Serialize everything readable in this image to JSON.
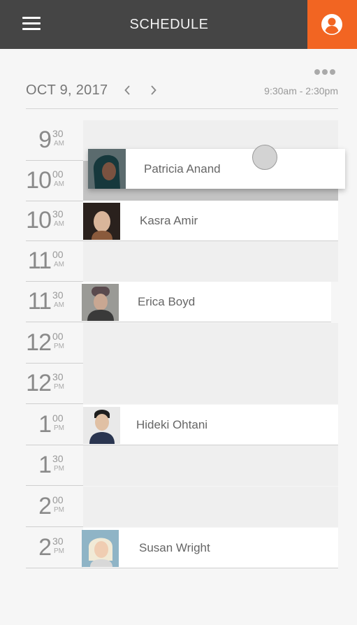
{
  "header": {
    "title": "SCHEDULE",
    "menu_icon": "hamburger-menu-icon",
    "user_icon": "user-profile-icon",
    "accent": "#f26522"
  },
  "toolbar": {
    "more_icon": "more-dots-icon"
  },
  "date_bar": {
    "date": "OCT 9, 2017",
    "range": "9:30am - 2:30pm",
    "prev_icon": "chevron-left-icon",
    "next_icon": "chevron-right-icon"
  },
  "dragging": {
    "name": "Patricia Anand"
  },
  "slots": [
    {
      "hour": "9",
      "min": "30",
      "ampm": "AM"
    },
    {
      "hour": "10",
      "min": "00",
      "ampm": "AM"
    },
    {
      "hour": "10",
      "min": "30",
      "ampm": "AM",
      "name": "Kasra Amir"
    },
    {
      "hour": "11",
      "min": "00",
      "ampm": "AM"
    },
    {
      "hour": "11",
      "min": "30",
      "ampm": "AM",
      "name": "Erica Boyd"
    },
    {
      "hour": "12",
      "min": "00",
      "ampm": "PM"
    },
    {
      "hour": "12",
      "min": "30",
      "ampm": "PM"
    },
    {
      "hour": "1",
      "min": "00",
      "ampm": "PM",
      "name": "Hideki Ohtani"
    },
    {
      "hour": "1",
      "min": "30",
      "ampm": "PM"
    },
    {
      "hour": "2",
      "min": "00",
      "ampm": "PM"
    },
    {
      "hour": "2",
      "min": "30",
      "ampm": "PM",
      "name": "Susan Wright"
    }
  ]
}
